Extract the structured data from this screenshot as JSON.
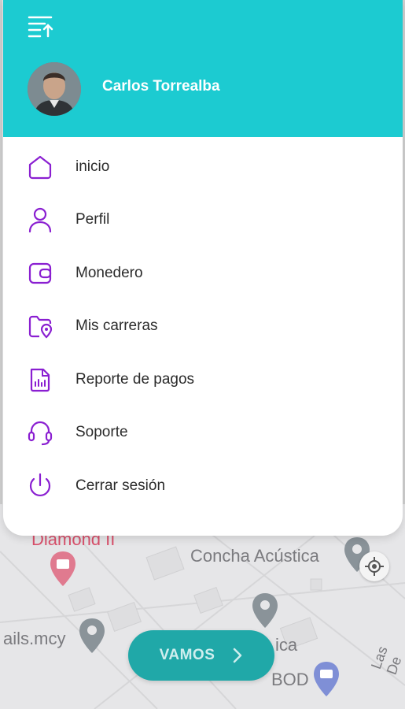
{
  "header": {
    "menu_icon": "menu-collapse-icon",
    "user_name": "Carlos Torrealba"
  },
  "menu": {
    "items": [
      {
        "label": "inicio",
        "icon": "home-icon"
      },
      {
        "label": "Perfil",
        "icon": "user-icon"
      },
      {
        "label": "Monedero",
        "icon": "wallet-icon"
      },
      {
        "label": "Mis carreras",
        "icon": "folder-location-icon"
      },
      {
        "label": "Reporte de pagos",
        "icon": "report-icon"
      },
      {
        "label": "Soporte",
        "icon": "headset-icon"
      },
      {
        "label": "Cerrar sesión",
        "icon": "power-icon"
      }
    ]
  },
  "map": {
    "labels": {
      "diamond": "Diamond II",
      "concha": "Concha Acústica",
      "mails": "ails.mcy",
      "ica": "ica",
      "bod": "BOD",
      "las": "Las De"
    }
  },
  "actions": {
    "go_label": "VAMOS"
  },
  "colors": {
    "header": "#1ccbd1",
    "icon_accent": "#8a1fd1",
    "go_button": "#20a8a8"
  }
}
